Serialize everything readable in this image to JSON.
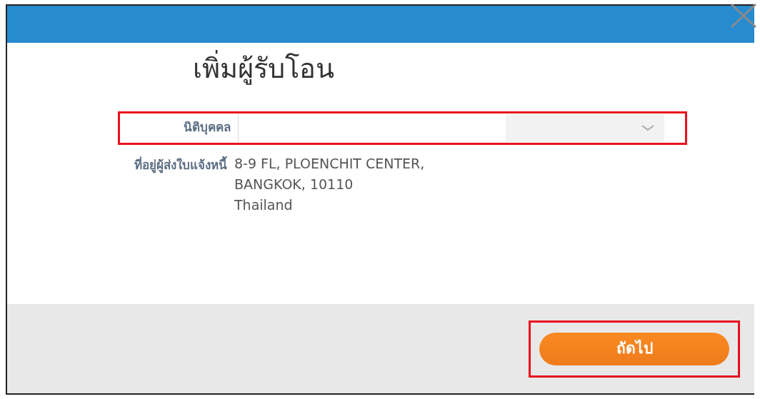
{
  "dialog": {
    "title": "เพิ่มผู้รับโอน"
  },
  "fields": [
    {
      "kind": "select",
      "label": "นิติบุคคล",
      "highlighted": true
    },
    {
      "kind": "text",
      "label": "ที่อยู่ผู้ส่งใบแจ้งหนี้",
      "lines": [
        "8-9 FL, PLOENCHIT CENTER,",
        "BANGKOK, 10110",
        "Thailand"
      ]
    }
  ],
  "footer": {
    "button": {
      "label": "ถัดไป",
      "highlighted": true
    }
  }
}
